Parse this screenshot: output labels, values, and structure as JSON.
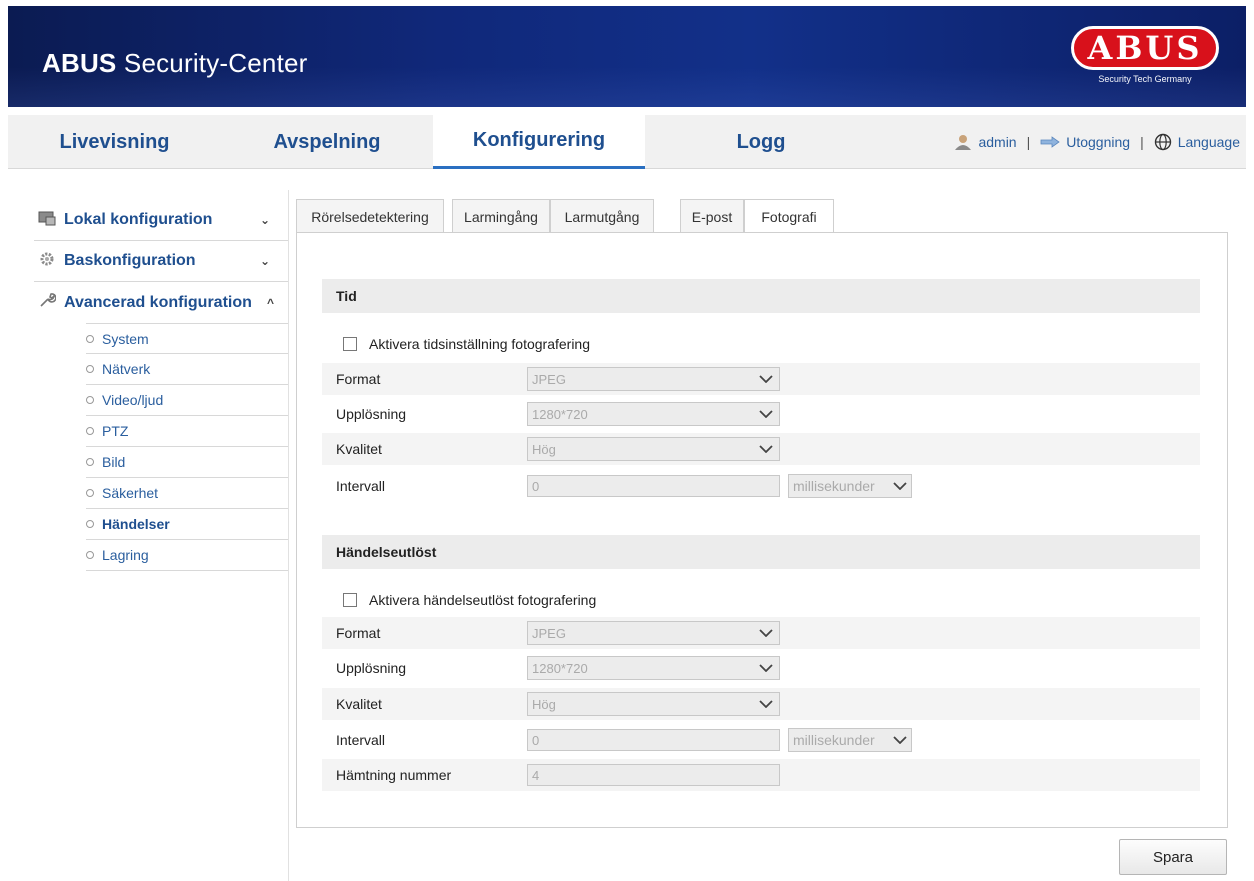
{
  "header": {
    "brand_bold": "ABUS",
    "brand_rest": " Security-Center",
    "logo_text": "ABUS",
    "logo_tagline": "Security Tech Germany",
    "colors": {
      "banner": "#10287a",
      "logo_red": "#d8111b"
    }
  },
  "nav": {
    "tabs": [
      {
        "label": "Livevisning"
      },
      {
        "label": "Avspelning"
      },
      {
        "label": "Konfigurering"
      },
      {
        "label": "Logg"
      }
    ],
    "active_tab": "Konfigurering",
    "user": "admin",
    "logout": "Utoggning",
    "language": "Language",
    "separator": "|"
  },
  "sidebar": {
    "sections": [
      {
        "label": "Lokal konfiguration",
        "icon": "monitor-icon",
        "chevron": "⌄"
      },
      {
        "label": "Baskonfiguration",
        "icon": "gear-icon",
        "chevron": "⌄"
      },
      {
        "label": "Avancerad konfiguration",
        "icon": "wrench-icon",
        "chevron": "^"
      }
    ],
    "items": [
      "System",
      "Nätverk",
      "Video/ljud",
      "PTZ",
      "Bild",
      "Säkerhet",
      "Händelser",
      "Lagring"
    ],
    "active_item": "Händelser"
  },
  "tabs": [
    "Rörelsedetektering",
    "Larmingång",
    "Larmutgång",
    "E-post",
    "Fotografi"
  ],
  "active_subtab": "Fotografi",
  "tid": {
    "title": "Tid",
    "enable_label": "Aktivera tidsinställning fotografering",
    "format_label": "Format",
    "format_value": "JPEG",
    "resolution_label": "Upplösning",
    "resolution_value": "1280*720",
    "quality_label": "Kvalitet",
    "quality_value": "Hög",
    "interval_label": "Intervall",
    "interval_value": "0",
    "interval_unit": "millisekunder"
  },
  "event": {
    "title": "Händelseutlöst",
    "enable_label": "Aktivera händelseutlöst fotografering",
    "format_label": "Format",
    "format_value": "JPEG",
    "resolution_label": "Upplösning",
    "resolution_value": "1280*720",
    "quality_label": "Kvalitet",
    "quality_value": "Hög",
    "interval_label": "Intervall",
    "interval_value": "0",
    "interval_unit": "millisekunder",
    "capture_label": "Hämtning nummer",
    "capture_value": "4"
  },
  "save_label": "Spara"
}
